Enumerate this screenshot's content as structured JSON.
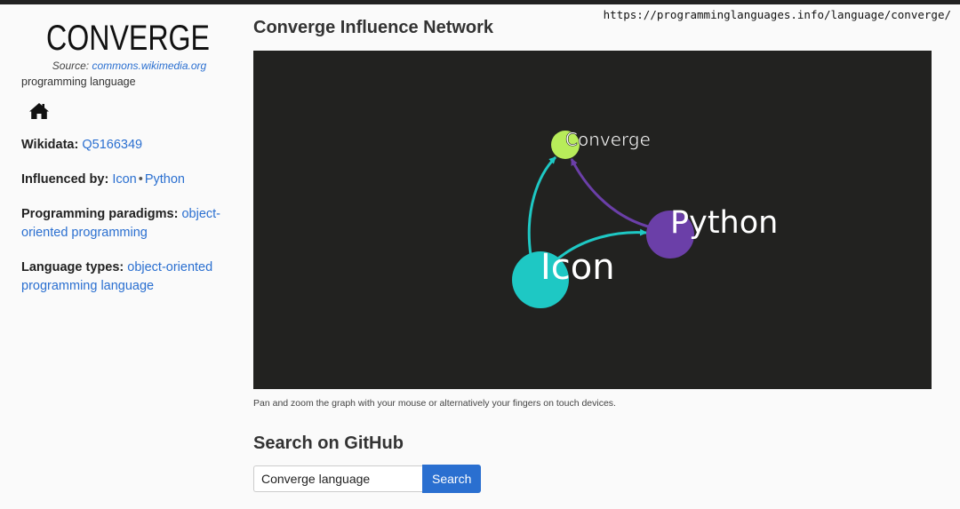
{
  "browser": {
    "url": "https://programminglanguages.info/language/converge/"
  },
  "sidebar": {
    "logo_text": "CONVERGE",
    "source_label": "Source:",
    "source_link": "commons.wikimedia.org",
    "kind": "programming language",
    "home_icon": "home-icon",
    "wikidata": {
      "label": "Wikidata:",
      "value": "Q5166349"
    },
    "influenced_by": {
      "label": "Influenced by:",
      "items": [
        "Icon",
        "Python"
      ],
      "separator": "•"
    },
    "paradigms": {
      "label": "Programming paradigms:",
      "value": "object-oriented programming"
    },
    "types": {
      "label": "Language types:",
      "value": "object-oriented programming language"
    }
  },
  "main": {
    "title": "Converge Influence Network",
    "graph": {
      "nodes": [
        {
          "label": "Converge",
          "color": "#b8ec5a"
        },
        {
          "label": "Python",
          "color": "#6b3fa8"
        },
        {
          "label": "Icon",
          "color": "#1ec8c4"
        }
      ],
      "edges": [
        {
          "from": "Icon",
          "to": "Converge",
          "color": "#1ec8c4"
        },
        {
          "from": "Icon",
          "to": "Python",
          "color": "#1ec8c4"
        },
        {
          "from": "Python",
          "to": "Converge",
          "color": "#6b3fa8"
        }
      ],
      "background": "#222220"
    },
    "hint": "Pan and zoom the graph with your mouse or alternatively your fingers on touch devices.",
    "github_title": "Search on GitHub",
    "search": {
      "value": "Converge language",
      "button": "Search"
    }
  }
}
